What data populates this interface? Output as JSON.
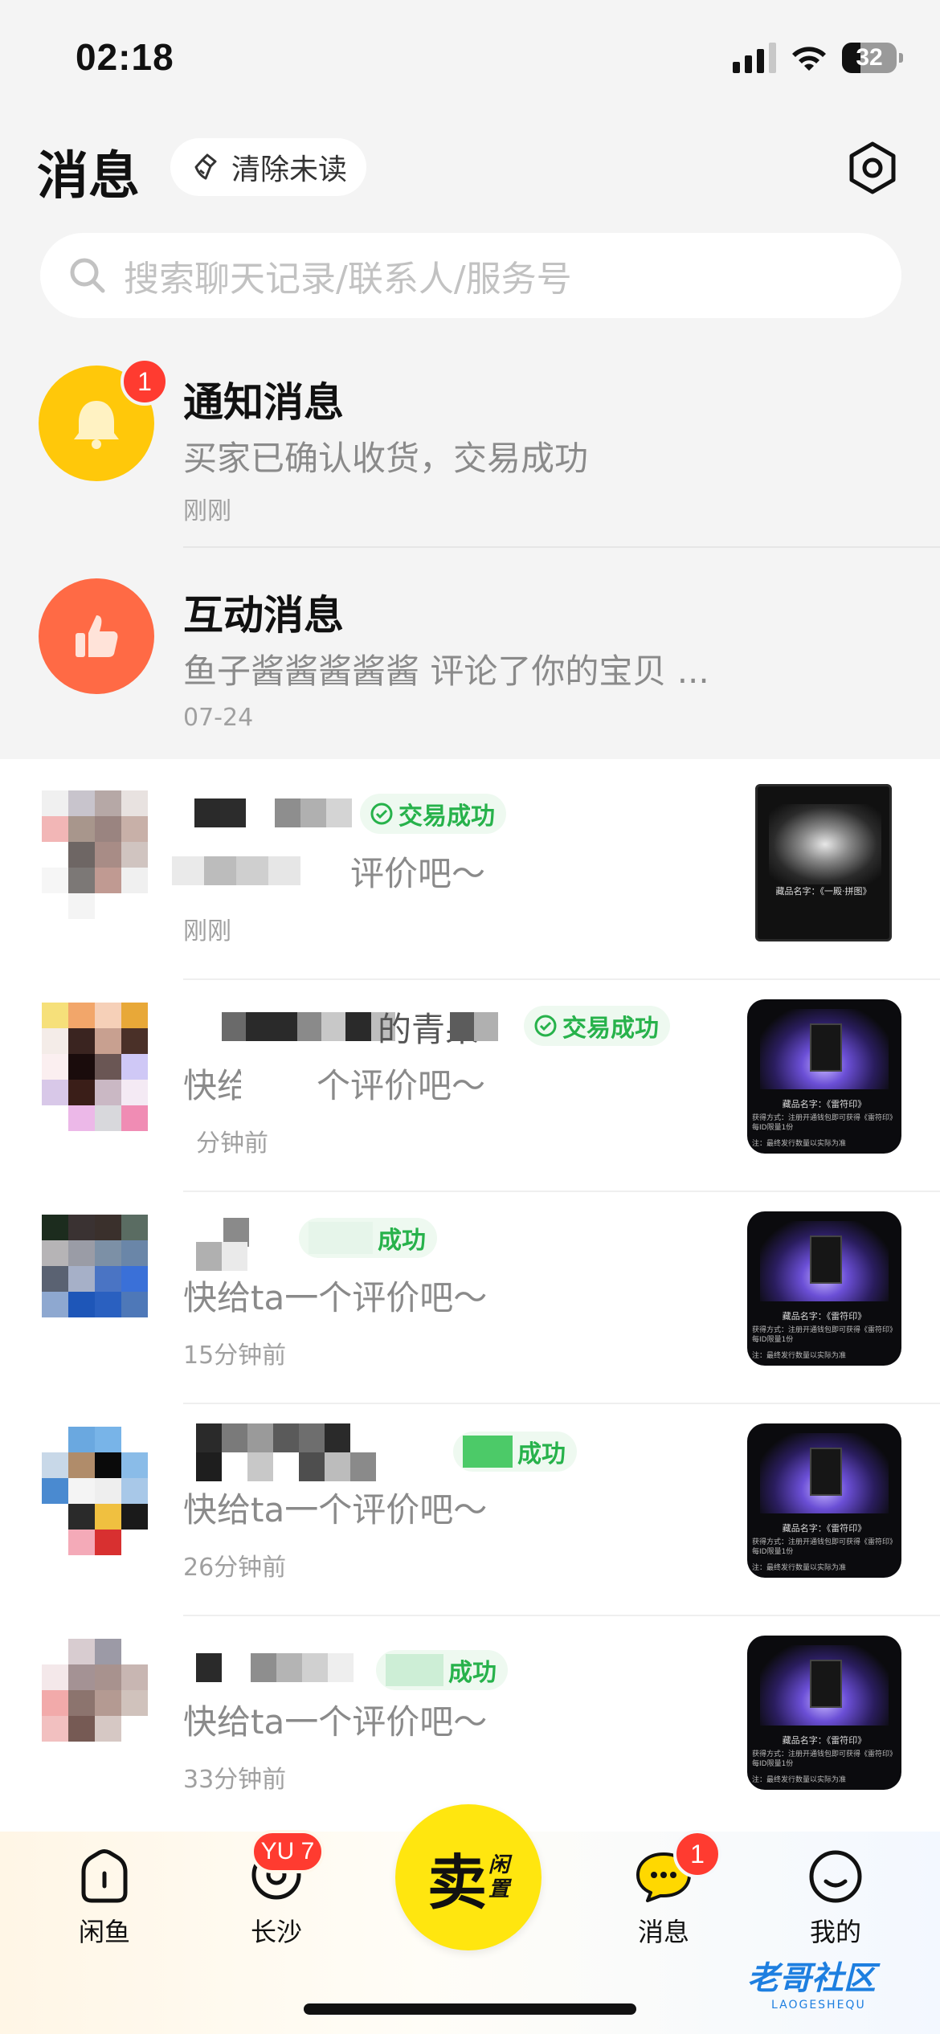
{
  "status_bar": {
    "time": "02:18",
    "battery": "32"
  },
  "header": {
    "title": "消息",
    "clear_unread": "清除未读"
  },
  "search": {
    "placeholder": "搜索聊天记录/联系人/服务号"
  },
  "system_messages": [
    {
      "title": "通知消息",
      "subtitle": "买家已确认收货，交易成功",
      "time": "刚刚",
      "badge": "1",
      "icon": "bell-icon",
      "color": "#ffc80a"
    },
    {
      "title": "互动消息",
      "subtitle": "鱼子酱酱酱酱酱 评论了你的宝贝 ...",
      "time": "07-24",
      "icon": "thumbs-up-icon",
      "color": "#ff6a45"
    }
  ],
  "chats": [
    {
      "status": "交易成功",
      "preview": "评价吧～",
      "time": "刚刚",
      "thumb_title": "藏品名字：《一殿·拼图》"
    },
    {
      "name_fragment": "的青果",
      "status": "交易成功",
      "preview": "快给t",
      "preview_tail": "个评价吧～",
      "time": "分钟前",
      "thumb_title": "藏品名字：《雷符印》"
    },
    {
      "status": "成功",
      "preview": "快给ta一个评价吧～",
      "time": "15分钟前",
      "thumb_title": "藏品名字：《雷符印》"
    },
    {
      "status": "成功",
      "preview": "快给ta一个评价吧～",
      "time": "26分钟前",
      "thumb_title": "藏品名字：《雷符印》"
    },
    {
      "status": "成功",
      "preview": "快给ta一个评价吧～",
      "time": "33分钟前",
      "thumb_title": "藏品名字：《雷符印》"
    }
  ],
  "thumb_text": {
    "line1": "获得方式：注册开通钱包即可获得《雷符印》每ID限量1份",
    "line2": "注：最终发行数量以实际为准"
  },
  "tabbar": {
    "items": [
      {
        "label": "闲鱼",
        "icon": "home-icon"
      },
      {
        "label": "长沙",
        "icon": "location-icon",
        "badge": "YU 7"
      },
      {
        "label": "消息",
        "icon": "message-icon",
        "badge": "1"
      },
      {
        "label": "我的",
        "icon": "smile-face-icon"
      }
    ],
    "sell_main": "卖",
    "sell_side_top": "闲",
    "sell_side_bottom": "置"
  },
  "watermark": {
    "main": "老哥社区",
    "sub": "LAOGESHEQU"
  },
  "colors": {
    "accent_yellow": "#ffe60f",
    "success_green": "#27b24b",
    "badge_red": "#ff3b30"
  }
}
